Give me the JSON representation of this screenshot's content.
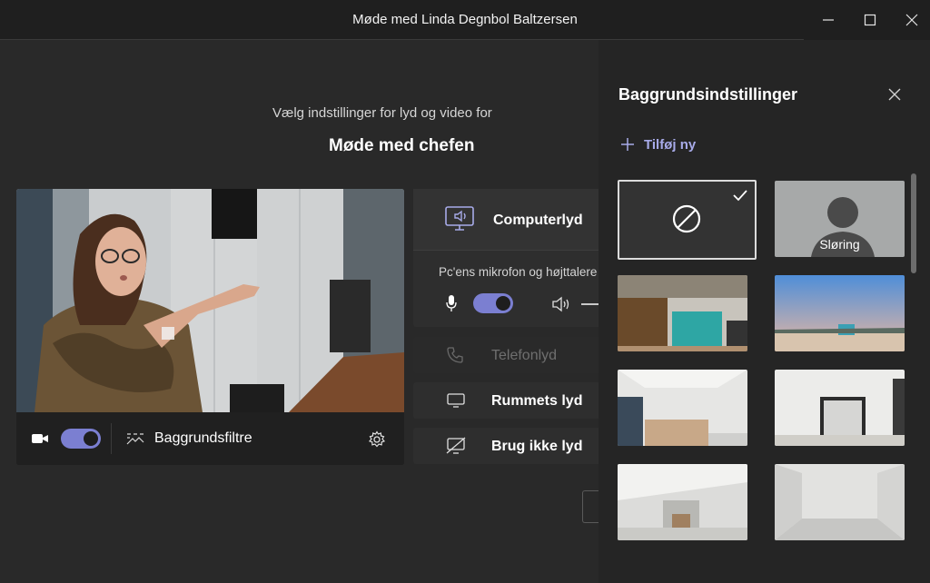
{
  "window": {
    "title": "Møde med Linda Degnbol Baltzersen"
  },
  "prejoin": {
    "subtitle": "Vælg indstillinger for lyd og video for",
    "meeting_title": "Møde med chefen"
  },
  "video": {
    "background_filters_label": "Baggrundsfiltre",
    "camera_on": true
  },
  "audio": {
    "computer_label": "Computerlyd",
    "computer_desc": "Pc'ens mikrofon og højttalere",
    "mic_on": true,
    "phone_label": "Telefonlyd",
    "room_label": "Rummets lyd",
    "none_label": "Brug ikke lyd"
  },
  "background_panel": {
    "title": "Baggrundsindstillinger",
    "add_new_label": "Tilføj ny",
    "blur_label": "Sløring"
  },
  "colors": {
    "accent": "#7b7fd1",
    "accent_text": "#a8abe9"
  }
}
